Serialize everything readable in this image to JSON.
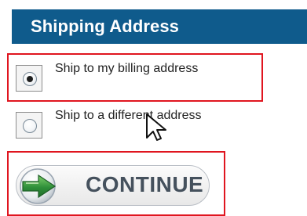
{
  "section": {
    "title": "Shipping Address"
  },
  "shipping_options": [
    {
      "label": "Ship to my billing address",
      "selected": true
    },
    {
      "label": "Ship to a different address",
      "selected": false
    }
  ],
  "continue_button": {
    "label": "CONTINUE",
    "icon": "green-arrow-icon"
  },
  "colors": {
    "header_bg": "#0f5b8c",
    "highlight_border": "#e0151f",
    "arrow_green": "#2f8f3a",
    "button_text": "#45515d"
  }
}
